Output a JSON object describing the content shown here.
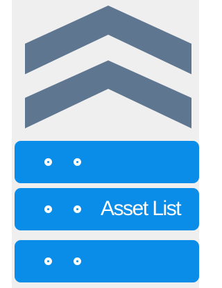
{
  "diagram": {
    "chevron_color": "#5f7690",
    "server_color": "#0a8de8",
    "background_color": "#efefef",
    "servers": [
      {
        "label": ""
      },
      {
        "label": "Asset List"
      },
      {
        "label": ""
      }
    ]
  }
}
